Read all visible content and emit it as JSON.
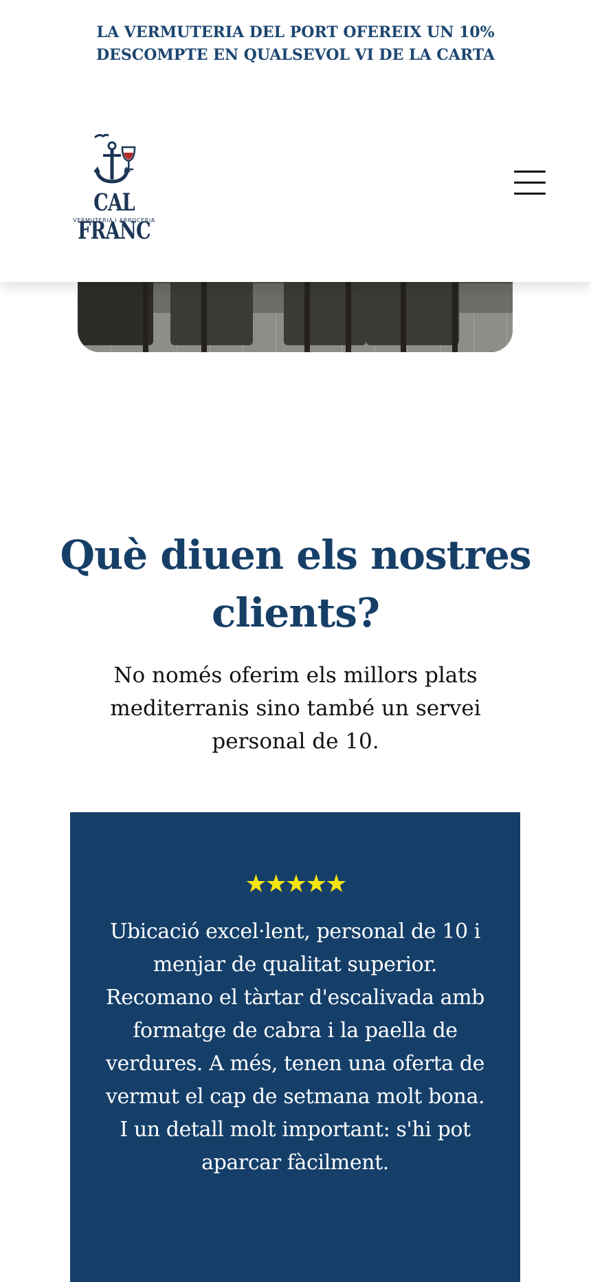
{
  "promo": {
    "line1": "LA VERMUTERIA DEL PORT OFEREIX UN 10%",
    "line2": "DESCOMPTE EN QUALSEVOL VI DE LA CARTA"
  },
  "header": {
    "logo_name": "CAL FRANC",
    "logo_subtitle": "VERMUTERIA I ARROCERIA",
    "menu_icon": "hamburger-menu-icon"
  },
  "testimonials": {
    "title": "Què diuen els nostres clients?",
    "intro": "No només oferim els millors plats mediterranis sino també un servei personal de 10.",
    "review": {
      "rating": 5,
      "stars": "★★★★★",
      "text": "Ubicació excel·lent, personal de 10 i menjar de qualitat superior. Recomano el tàrtar d'escalivada amb formatge de cabra i la paella de verdures. A més, tenen una oferta de vermut el cap de setmana molt bona. I un detall molt important: s'hi pot aparcar fàcilment."
    }
  },
  "colors": {
    "brand_navy": "#153f69",
    "title_blue": "#163f68",
    "star_yellow": "#f5e410"
  }
}
